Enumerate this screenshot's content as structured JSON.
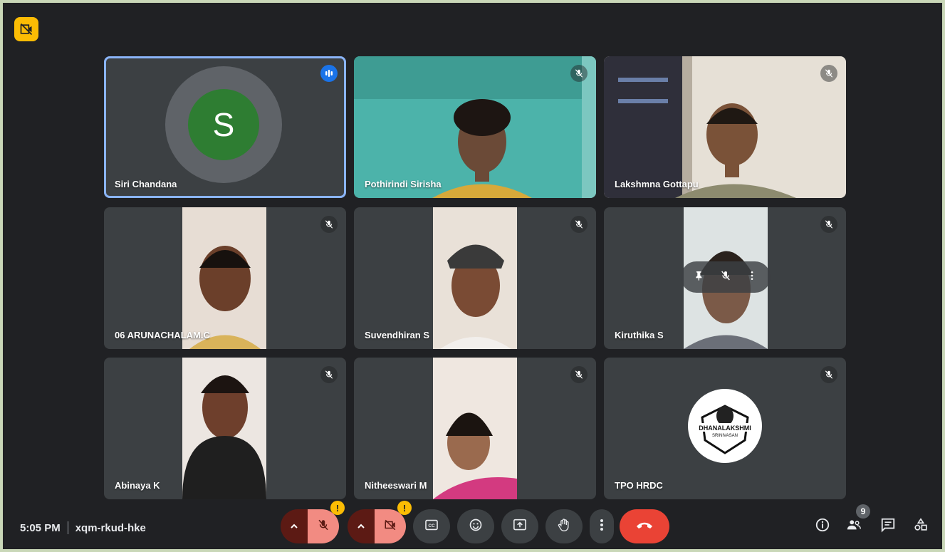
{
  "meeting": {
    "time": "5:05 PM",
    "code": "xqm-rkud-hke"
  },
  "participants_count": "9",
  "warning_badge": "!",
  "participants": [
    {
      "name": "Siri Chandana",
      "avatar_letter": "S",
      "avatar_color": "#2e7d32",
      "state": "speaking"
    },
    {
      "name": "Pothirindi Sirisha",
      "state": "muted"
    },
    {
      "name": "Lakshmna Gottapu",
      "state": "muted"
    },
    {
      "name": "06 ARUNACHALAM.C",
      "state": "muted"
    },
    {
      "name": "Suvendhiran S",
      "state": "muted"
    },
    {
      "name": "Kiruthika S",
      "state": "muted"
    },
    {
      "name": "Abinaya K",
      "state": "muted"
    },
    {
      "name": "Nitheeswari M",
      "state": "muted"
    },
    {
      "name": "TPO HRDC",
      "state": "muted",
      "logo_text": "DHANALAKSHMI SRINIVASAN"
    }
  ],
  "icons": {
    "corner": "camera-off-icon",
    "controls": [
      "chevron-up-icon",
      "mic-off-icon",
      "chevron-up-icon",
      "camera-off-icon",
      "captions-icon",
      "emoji-icon",
      "present-icon",
      "raise-hand-icon",
      "more-vert-icon",
      "end-call-icon"
    ],
    "right": [
      "info-icon",
      "people-icon",
      "chat-icon",
      "activities-icon"
    ]
  },
  "colors": {
    "background": "#202124",
    "tile": "#3c4043",
    "accent": "#8ab4f8",
    "end_call": "#ea4335",
    "muted_control": "#f28b82",
    "warning": "#fbbc04"
  }
}
